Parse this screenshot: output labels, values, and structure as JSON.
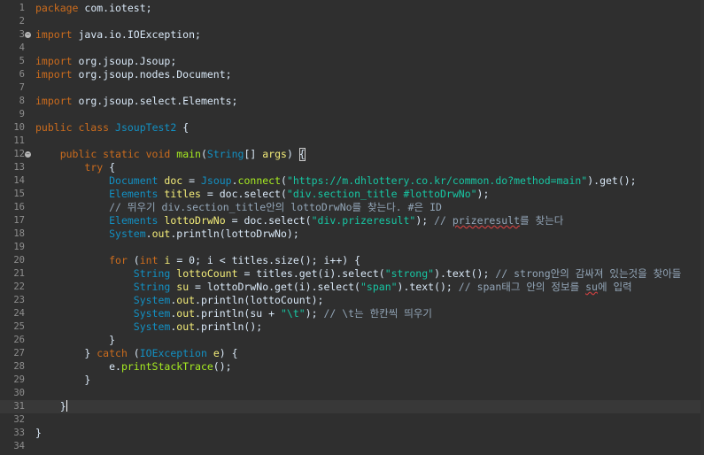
{
  "editor": {
    "current_line": 31,
    "cursor_line": 31,
    "lines": [
      {
        "n": "1",
        "segments": [
          {
            "t": "package",
            "c": "kw"
          },
          {
            "t": " com.iotest;",
            "c": "pl"
          }
        ]
      },
      {
        "n": "2",
        "segments": []
      },
      {
        "n": "3",
        "fold": true,
        "segments": [
          {
            "t": "import",
            "c": "kw"
          },
          {
            "t": " java.io.IOException;",
            "c": "pl"
          }
        ]
      },
      {
        "n": "4",
        "segments": []
      },
      {
        "n": "5",
        "segments": [
          {
            "t": "import",
            "c": "kw"
          },
          {
            "t": " org.jsoup.Jsoup;",
            "c": "pl"
          }
        ]
      },
      {
        "n": "6",
        "segments": [
          {
            "t": "import",
            "c": "kw"
          },
          {
            "t": " org.jsoup.nodes.Document;",
            "c": "pl"
          }
        ]
      },
      {
        "n": "7",
        "segments": []
      },
      {
        "n": "8",
        "segments": [
          {
            "t": "import",
            "c": "kw"
          },
          {
            "t": " org.jsoup.select.Elements;",
            "c": "pl"
          }
        ]
      },
      {
        "n": "9",
        "segments": []
      },
      {
        "n": "10",
        "segments": [
          {
            "t": "public class",
            "c": "kw"
          },
          {
            "t": " ",
            "c": "pl"
          },
          {
            "t": "JsoupTest2",
            "c": "ty"
          },
          {
            "t": " {",
            "c": "pl"
          }
        ]
      },
      {
        "n": "11",
        "segments": []
      },
      {
        "n": "12",
        "fold": true,
        "segments": [
          {
            "t": "    ",
            "c": "pl"
          },
          {
            "t": "public static void",
            "c": "kw"
          },
          {
            "t": " ",
            "c": "pl"
          },
          {
            "t": "main",
            "c": "fn"
          },
          {
            "t": "(",
            "c": "pl"
          },
          {
            "t": "String",
            "c": "ty"
          },
          {
            "t": "[] ",
            "c": "pl"
          },
          {
            "t": "args",
            "c": "id"
          },
          {
            "t": ") ",
            "c": "pl"
          },
          {
            "t": "{",
            "c": "pl",
            "box": true
          }
        ]
      },
      {
        "n": "13",
        "segments": [
          {
            "t": "        ",
            "c": "pl"
          },
          {
            "t": "try",
            "c": "kw"
          },
          {
            "t": " {",
            "c": "pl"
          }
        ]
      },
      {
        "n": "14",
        "segments": [
          {
            "t": "            ",
            "c": "pl"
          },
          {
            "t": "Document",
            "c": "ty"
          },
          {
            "t": " ",
            "c": "pl"
          },
          {
            "t": "doc",
            "c": "id"
          },
          {
            "t": " = ",
            "c": "pl"
          },
          {
            "t": "Jsoup",
            "c": "ty"
          },
          {
            "t": ".",
            "c": "pl"
          },
          {
            "t": "connect",
            "c": "fn"
          },
          {
            "t": "(",
            "c": "pl"
          },
          {
            "t": "\"https://m.dhlottery.co.kr/common.do?method=main\"",
            "c": "st"
          },
          {
            "t": ").get();",
            "c": "pl"
          }
        ]
      },
      {
        "n": "15",
        "segments": [
          {
            "t": "            ",
            "c": "pl"
          },
          {
            "t": "Elements",
            "c": "ty"
          },
          {
            "t": " ",
            "c": "pl"
          },
          {
            "t": "titles",
            "c": "id"
          },
          {
            "t": " = doc.select(",
            "c": "pl"
          },
          {
            "t": "\"div.section_title #lottoDrwNo\"",
            "c": "st"
          },
          {
            "t": ");",
            "c": "pl"
          }
        ]
      },
      {
        "n": "16",
        "segments": [
          {
            "t": "            ",
            "c": "pl"
          },
          {
            "t": "// 뛰우기 div.section_title안의 lottoDrwNo를 찾는다. #은 ID",
            "c": "cm"
          }
        ]
      },
      {
        "n": "17",
        "segments": [
          {
            "t": "            ",
            "c": "pl"
          },
          {
            "t": "Elements",
            "c": "ty"
          },
          {
            "t": " ",
            "c": "pl"
          },
          {
            "t": "lottoDrwNo",
            "c": "id"
          },
          {
            "t": " = doc.select(",
            "c": "pl"
          },
          {
            "t": "\"div.prizeresult\"",
            "c": "st"
          },
          {
            "t": "); ",
            "c": "pl"
          },
          {
            "t": "// ",
            "c": "cm"
          },
          {
            "t": "prizeresult",
            "c": "cm",
            "wavy": true
          },
          {
            "t": "를 찾는다",
            "c": "cm"
          }
        ]
      },
      {
        "n": "18",
        "segments": [
          {
            "t": "            ",
            "c": "pl"
          },
          {
            "t": "System",
            "c": "ty"
          },
          {
            "t": ".",
            "c": "pl"
          },
          {
            "t": "out",
            "c": "id"
          },
          {
            "t": ".println(lottoDrwNo);",
            "c": "pl"
          }
        ]
      },
      {
        "n": "19",
        "segments": []
      },
      {
        "n": "20",
        "segments": [
          {
            "t": "            ",
            "c": "pl"
          },
          {
            "t": "for",
            "c": "kw"
          },
          {
            "t": " (",
            "c": "pl"
          },
          {
            "t": "int",
            "c": "kw"
          },
          {
            "t": " ",
            "c": "pl"
          },
          {
            "t": "i",
            "c": "id"
          },
          {
            "t": " = 0; i < titles.size(); i++) {",
            "c": "pl"
          }
        ]
      },
      {
        "n": "21",
        "segments": [
          {
            "t": "                ",
            "c": "pl"
          },
          {
            "t": "String",
            "c": "ty"
          },
          {
            "t": " ",
            "c": "pl"
          },
          {
            "t": "lottoCount",
            "c": "id"
          },
          {
            "t": " = titles.get(i).select(",
            "c": "pl"
          },
          {
            "t": "\"strong\"",
            "c": "st"
          },
          {
            "t": ").text(); ",
            "c": "pl"
          },
          {
            "t": "// strong안의 감싸져 있는것을 찾아들",
            "c": "cm"
          }
        ]
      },
      {
        "n": "22",
        "segments": [
          {
            "t": "                ",
            "c": "pl"
          },
          {
            "t": "String",
            "c": "ty"
          },
          {
            "t": " ",
            "c": "pl"
          },
          {
            "t": "su",
            "c": "id"
          },
          {
            "t": " = lottoDrwNo.get(i).select(",
            "c": "pl"
          },
          {
            "t": "\"span\"",
            "c": "st"
          },
          {
            "t": ").text(); ",
            "c": "pl"
          },
          {
            "t": "// span태그 안의 정보를 ",
            "c": "cm"
          },
          {
            "t": "su",
            "c": "cm",
            "wavy": true
          },
          {
            "t": "에 입력",
            "c": "cm"
          }
        ]
      },
      {
        "n": "23",
        "segments": [
          {
            "t": "                ",
            "c": "pl"
          },
          {
            "t": "System",
            "c": "ty"
          },
          {
            "t": ".",
            "c": "pl"
          },
          {
            "t": "out",
            "c": "id"
          },
          {
            "t": ".println(lottoCount);",
            "c": "pl"
          }
        ]
      },
      {
        "n": "24",
        "segments": [
          {
            "t": "                ",
            "c": "pl"
          },
          {
            "t": "System",
            "c": "ty"
          },
          {
            "t": ".",
            "c": "pl"
          },
          {
            "t": "out",
            "c": "id"
          },
          {
            "t": ".println(su + ",
            "c": "pl"
          },
          {
            "t": "\"\\t\"",
            "c": "st"
          },
          {
            "t": "); ",
            "c": "pl"
          },
          {
            "t": "// \\t는 한칸씩 띄우기",
            "c": "cm"
          }
        ]
      },
      {
        "n": "25",
        "segments": [
          {
            "t": "                ",
            "c": "pl"
          },
          {
            "t": "System",
            "c": "ty"
          },
          {
            "t": ".",
            "c": "pl"
          },
          {
            "t": "out",
            "c": "id"
          },
          {
            "t": ".println();",
            "c": "pl"
          }
        ]
      },
      {
        "n": "26",
        "segments": [
          {
            "t": "            }",
            "c": "pl"
          }
        ]
      },
      {
        "n": "27",
        "segments": [
          {
            "t": "        } ",
            "c": "pl"
          },
          {
            "t": "catch",
            "c": "kw"
          },
          {
            "t": " (",
            "c": "pl"
          },
          {
            "t": "IOException",
            "c": "ty"
          },
          {
            "t": " ",
            "c": "pl"
          },
          {
            "t": "e",
            "c": "id"
          },
          {
            "t": ") {",
            "c": "pl"
          }
        ]
      },
      {
        "n": "28",
        "segments": [
          {
            "t": "            e.",
            "c": "pl"
          },
          {
            "t": "printStackTrace",
            "c": "fn"
          },
          {
            "t": "();",
            "c": "pl"
          }
        ]
      },
      {
        "n": "29",
        "segments": [
          {
            "t": "        }",
            "c": "pl"
          }
        ]
      },
      {
        "n": "30",
        "segments": []
      },
      {
        "n": "31",
        "segments": [
          {
            "t": "    }",
            "c": "pl"
          }
        ]
      },
      {
        "n": "32",
        "segments": []
      },
      {
        "n": "33",
        "segments": [
          {
            "t": "}",
            "c": "pl"
          }
        ]
      },
      {
        "n": "34",
        "segments": []
      }
    ]
  }
}
